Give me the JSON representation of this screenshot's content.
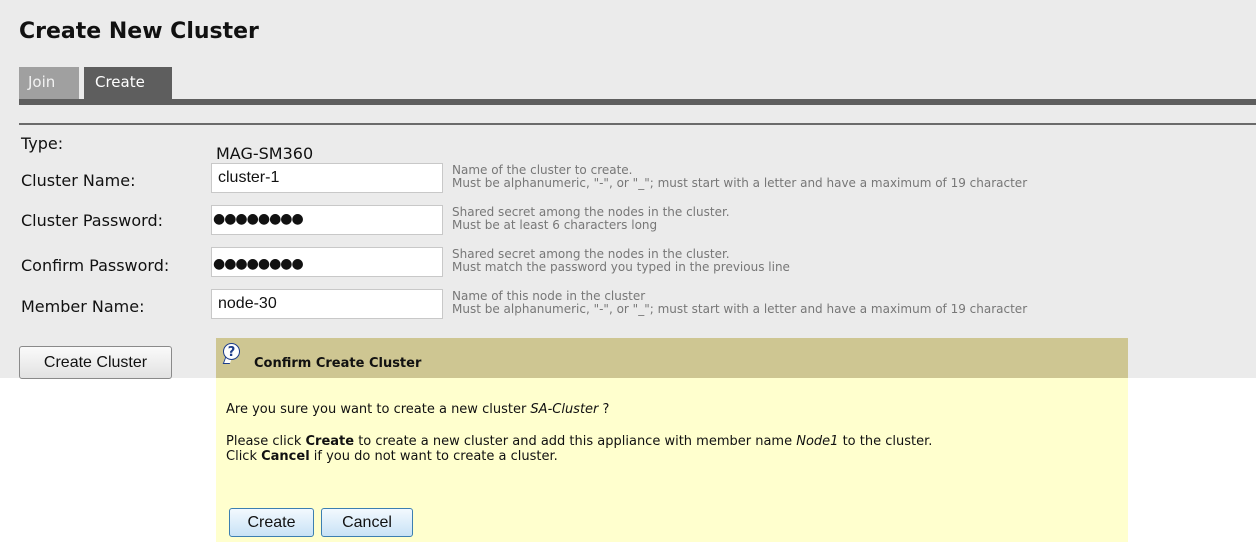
{
  "page": {
    "title": "Create New Cluster"
  },
  "tabs": [
    {
      "label": "Join"
    },
    {
      "label": "Create"
    }
  ],
  "form": {
    "type": {
      "label": "Type:",
      "value": "MAG-SM360"
    },
    "cluster_name": {
      "label": "Cluster Name:",
      "value": "cluster-1",
      "help_line1": "Name of the cluster to create.",
      "help_line2": "Must be alphanumeric, \"-\", or \"_\"; must start with a letter and have a maximum of 19 character"
    },
    "cluster_password": {
      "label": "Cluster Password:",
      "masked": "●●●●●●●●",
      "help_line1": "Shared secret among the nodes in the cluster.",
      "help_line2": "Must be at least 6 characters long"
    },
    "confirm_password": {
      "label": "Confirm Password:",
      "masked": "●●●●●●●●",
      "help_line1": "Shared secret among the nodes in the cluster.",
      "help_line2": "Must match the password you typed in the previous line"
    },
    "member_name": {
      "label": "Member Name:",
      "value": "node-30",
      "help_line1": "Name of this node in the cluster",
      "help_line2": "Must be alphanumeric, \"-\", or \"_\"; must start with a letter and have a maximum of 19 character"
    },
    "submit_label": "Create Cluster"
  },
  "dialog": {
    "icon": "question-icon",
    "icon_glyph": "?",
    "title": "Confirm Create Cluster",
    "line1_prefix": "Are you sure you want to create a new cluster ",
    "cluster_name": "SA-Cluster",
    "line1_suffix": " ?",
    "line2_prefix": "Please click ",
    "line2_create": "Create",
    "line2_middle": " to create a new cluster and add this appliance with member name ",
    "member_name": "Node1",
    "line2_suffix": " to the cluster.",
    "line3_prefix": "Click ",
    "line3_cancel": "Cancel",
    "line3_suffix": " if you do not want to create a cluster.",
    "create_label": "Create",
    "cancel_label": "Cancel"
  },
  "colors": {
    "panel_bg": "#ebebeb",
    "tab_active": "#5e5e5e",
    "tab_inactive": "#a0a0a0",
    "dialog_header": "#cec692",
    "dialog_body": "#ffffce",
    "help_text": "#777777",
    "dialog_button_border": "#3c7fb1"
  }
}
